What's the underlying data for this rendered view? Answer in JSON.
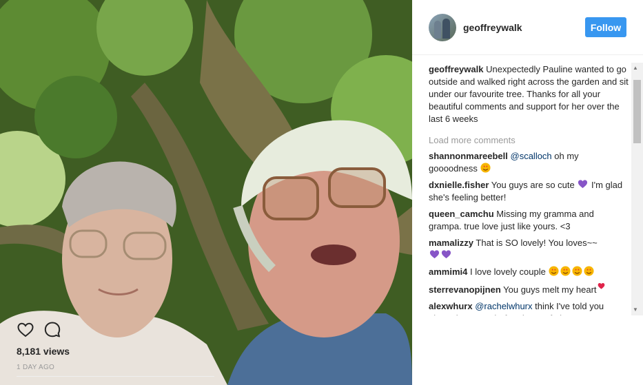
{
  "post": {
    "username": "geoffreywalk",
    "follow_label": "Follow",
    "caption_user": "geoffreywalk",
    "caption_text": " Unexpectedly Pauline wanted to go outside and walked right across the garden and sit under our favourite tree. Thanks for all your beautiful comments and support for her over the last 6 weeks",
    "load_more": "Load more comments",
    "likes": "8,181 views",
    "time": "1 DAY AGO"
  },
  "comments": [
    {
      "user": "shannonmareebell",
      "mention": "@scalloch",
      "text": " oh my goooodness"
    },
    {
      "user": "dxnielle.fisher",
      "text": " You guys are so cute",
      "text2": " I'm glad she's feeling better!"
    },
    {
      "user": "queen_camchu",
      "text": " Missing my gramma and grampa. true love just like yours. <3"
    },
    {
      "user": "mamalizzy",
      "text": " That is SO lovely! You loves~~"
    },
    {
      "user": "ammimi4",
      "text": " I love lovely couple"
    },
    {
      "user": "sterrevanopijnen",
      "text": " You guys melt my heart"
    },
    {
      "user": "alexwhurx",
      "mention": "@rachelwhurx",
      "text": " think I've told you about these two before but omfg how"
    }
  ],
  "colors": {
    "follow": "#3897f0",
    "link": "#003569",
    "muted": "#999999",
    "heart_purple": "#8755c7"
  }
}
